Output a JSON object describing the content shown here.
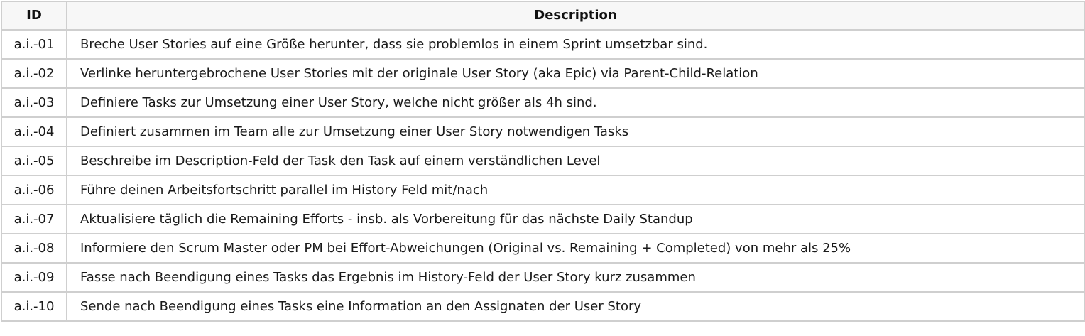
{
  "table": {
    "headers": {
      "id": "ID",
      "description": "Description"
    },
    "rows": [
      {
        "id": "a.i.-01",
        "description": "Breche User Stories auf eine Größe herunter, dass sie problemlos in einem Sprint umsetzbar sind."
      },
      {
        "id": "a.i.-02",
        "description": "Verlinke heruntergebrochene User Stories mit der originale User Story (aka Epic) via Parent-Child-Relation"
      },
      {
        "id": "a.i.-03",
        "description": "Definiere Tasks zur Umsetzung einer User Story, welche nicht größer als 4h sind."
      },
      {
        "id": "a.i.-04",
        "description": "Definiert zusammen im Team alle zur Umsetzung einer User Story notwendigen Tasks"
      },
      {
        "id": "a.i.-05",
        "description": "Beschreibe im Description-Feld der Task den Task auf einem verständlichen Level"
      },
      {
        "id": "a.i.-06",
        "description": "Führe deinen Arbeitsfortschritt parallel im History Feld mit/nach"
      },
      {
        "id": "a.i.-07",
        "description": "Aktualisiere täglich die Remaining Efforts - insb. als Vorbereitung für das nächste Daily Standup"
      },
      {
        "id": "a.i.-08",
        "description": "Informiere den Scrum Master oder PM bei Effort-Abweichungen (Original vs. Remaining + Completed) von mehr als 25%"
      },
      {
        "id": "a.i.-09",
        "description": "Fasse nach Beendigung eines Tasks das Ergebnis im History-Feld der User Story kurz zusammen"
      },
      {
        "id": "a.i.-10",
        "description": "Sende nach Beendigung eines Tasks eine Information an den Assignaten der User Story"
      }
    ]
  }
}
